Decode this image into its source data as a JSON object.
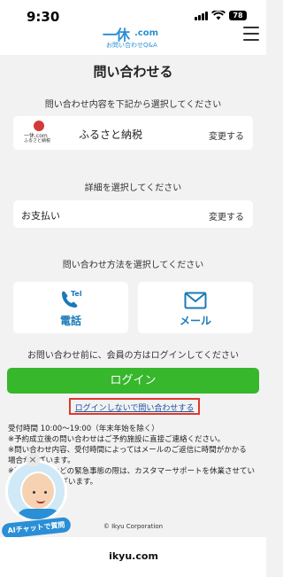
{
  "status_bar": {
    "time": "9:30",
    "battery": "78"
  },
  "header": {
    "logo_mark": "一休",
    "logo_domain": ".com",
    "logo_sub": "お問い合わせQ&A"
  },
  "page": {
    "title": "問い合わせる"
  },
  "inquiry_content": {
    "prompt": "問い合わせ内容を下記から選択してください",
    "service_logo_text": "一休.com",
    "service_logo_sub": "ふるさと納税",
    "service_name": "ふるさと納税",
    "change_label": "変更する"
  },
  "detail": {
    "prompt": "詳細を選択してください",
    "value": "お支払い",
    "change_label": "変更する"
  },
  "method": {
    "prompt": "問い合わせ方法を選択してください",
    "phone_icon_text": "Tel",
    "phone_label": "電話",
    "mail_label": "メール"
  },
  "login": {
    "prompt": "お問い合わせ前に、会員の方はログインしてください",
    "button_label": "ログイン",
    "guest_link": "ログインしないで問い合わせする"
  },
  "info_lines": [
    "受付時間 10:00〜19:00（年末年始を除く）",
    "※予約成立後の問い合わせはご予約施設に直接ご連絡ください。",
    "※問い合わせ内容、受付時間によってはメールのご返信に時間がかかる",
    "場合がございます。",
    "※荒天・災害などの緊急事態の際は、カスタマーサポートを休業させてい",
    "ただく場合がございます。"
  ],
  "ai_chat": {
    "label": "AIチャットで質問",
    "close": "×"
  },
  "footer": {
    "copyright": "© Ikyu Corporation"
  },
  "browser": {
    "url": "ikyu.com"
  },
  "colors": {
    "accent": "#37b72c",
    "brand": "#2a8fd6",
    "highlight": "#e0382b"
  }
}
